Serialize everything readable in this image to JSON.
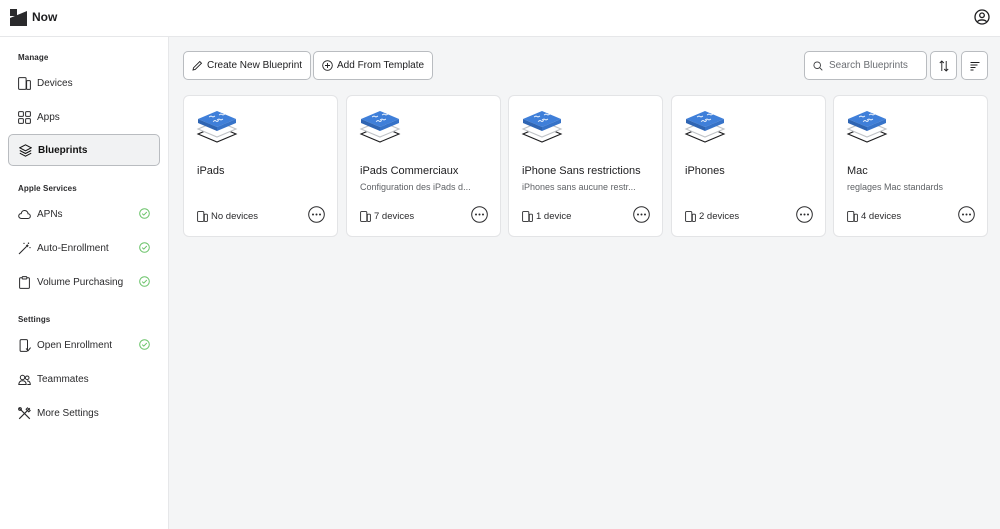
{
  "app": {
    "title": "Now",
    "logo_icon": "now-logo-icon",
    "account_icon": "account-icon"
  },
  "sidebar": {
    "sections": [
      {
        "label": "Manage"
      },
      {
        "label": "Apple Services"
      },
      {
        "label": "Settings"
      }
    ],
    "items": [
      {
        "label": "Devices",
        "icon": "devices-icon",
        "active": false,
        "status": ""
      },
      {
        "label": "Apps",
        "icon": "apps-grid-icon",
        "active": false,
        "status": ""
      },
      {
        "label": "Blueprints",
        "icon": "layers-icon",
        "active": true,
        "status": ""
      },
      {
        "label": "APNs",
        "icon": "cloud-icon",
        "active": false,
        "status": "ok"
      },
      {
        "label": "Auto-Enrollment",
        "icon": "magic-wand-icon",
        "active": false,
        "status": "ok"
      },
      {
        "label": "Volume Purchasing",
        "icon": "clipboard-icon",
        "active": false,
        "status": "ok"
      },
      {
        "label": "Open Enrollment",
        "icon": "phone-enroll-icon",
        "active": false,
        "status": "ok"
      },
      {
        "label": "Teammates",
        "icon": "people-icon",
        "active": false,
        "status": ""
      },
      {
        "label": "More Settings",
        "icon": "tools-icon",
        "active": false,
        "status": ""
      }
    ]
  },
  "toolbar": {
    "create_label": "Create New Blueprint",
    "template_label": "Add From Template",
    "search_placeholder": "Search Blueprints",
    "search_value": "",
    "sort_icon": "sort-icon",
    "view_icon": "list-view-icon"
  },
  "blueprints": [
    {
      "title": "iPads",
      "subtitle": "",
      "devices": "No devices"
    },
    {
      "title": "iPads Commerciaux",
      "subtitle": "Configuration des iPads d...",
      "devices": "7 devices"
    },
    {
      "title": "iPhone Sans restrictions",
      "subtitle": "iPhones sans aucune restr...",
      "devices": "1 device"
    },
    {
      "title": "iPhones",
      "subtitle": "",
      "devices": "2 devices"
    },
    {
      "title": "Mac",
      "subtitle": "reglages Mac standards",
      "devices": "4 devices"
    }
  ],
  "colors": {
    "accent": "#3f7fd9",
    "ok": "#6cc46b",
    "border": "#b9bcc0"
  }
}
